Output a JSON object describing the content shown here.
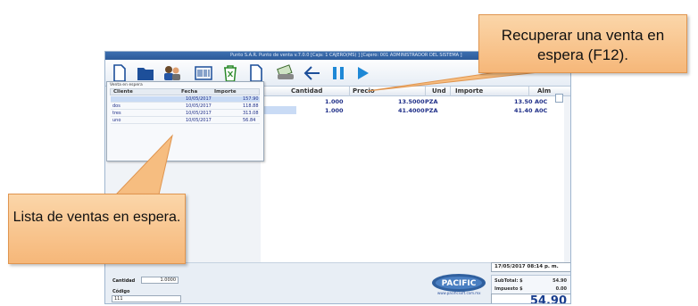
{
  "window": {
    "title": "Punto S.A.R. Punto de venta v.7.0.0 [Caja: 1 CAJERO(MS) ] [Cajero: 001 ADMINISTRADOR DEL SISTEMA ]"
  },
  "toolbar": {
    "buttons": [
      {
        "name": "new-document-icon"
      },
      {
        "name": "folder-icon"
      },
      {
        "name": "customers-icon"
      },
      {
        "name": "barcode-icon"
      },
      {
        "name": "trash-icon"
      },
      {
        "name": "document-icon"
      },
      {
        "name": "cash-icon"
      },
      {
        "name": "back-arrow-icon"
      },
      {
        "name": "pause-icon"
      },
      {
        "name": "play-icon"
      }
    ]
  },
  "grid": {
    "headers": {
      "cantidad": "Cantidad",
      "precio": "Precio",
      "und": "Und",
      "importe": "Importe",
      "alm": "Alm"
    },
    "rows": [
      {
        "cantidad": "1.000",
        "precio": "13.5000",
        "und": "PZA",
        "importe": "13.50",
        "alm": "A0C"
      },
      {
        "cantidad": "1.000",
        "precio": "41.4000",
        "und": "PZA",
        "importe": "41.40",
        "alm": "A0C"
      }
    ]
  },
  "popup": {
    "title": "Venta en espera",
    "headers": {
      "cliente": "Cliente",
      "fecha": "Fecha",
      "importe": "Importe"
    },
    "rows": [
      {
        "cliente": "",
        "fecha": "10/05/2017",
        "importe": "157.90"
      },
      {
        "cliente": "dos",
        "fecha": "10/05/2017",
        "importe": "118.88"
      },
      {
        "cliente": "tres",
        "fecha": "10/05/2017",
        "importe": "313.08"
      },
      {
        "cliente": "uno",
        "fecha": "10/05/2017",
        "importe": "56.84"
      }
    ]
  },
  "bottom": {
    "cantidad_label": "Cantidad",
    "cantidad_value": "1.0000",
    "codigo_label": "Código",
    "codigo_value": "111",
    "datetime": "17/05/2017  08:14 p. m.",
    "subtotal_label": "SubTotal: $",
    "subtotal_value": "54.90",
    "impuesto_label": "Impuesto $",
    "impuesto_value": "0.00",
    "total": "54.90",
    "logo_text": "PACIFIC",
    "logo_url": "www.pacificsoft.com.mx"
  },
  "callouts": {
    "recuperar": "Recuperar una venta en espera (F12).",
    "lista": "Lista de ventas en espera."
  },
  "colors": {
    "callout_fill": "#f8c488",
    "accent": "#1a3f8f",
    "play": "#1e88d6"
  }
}
